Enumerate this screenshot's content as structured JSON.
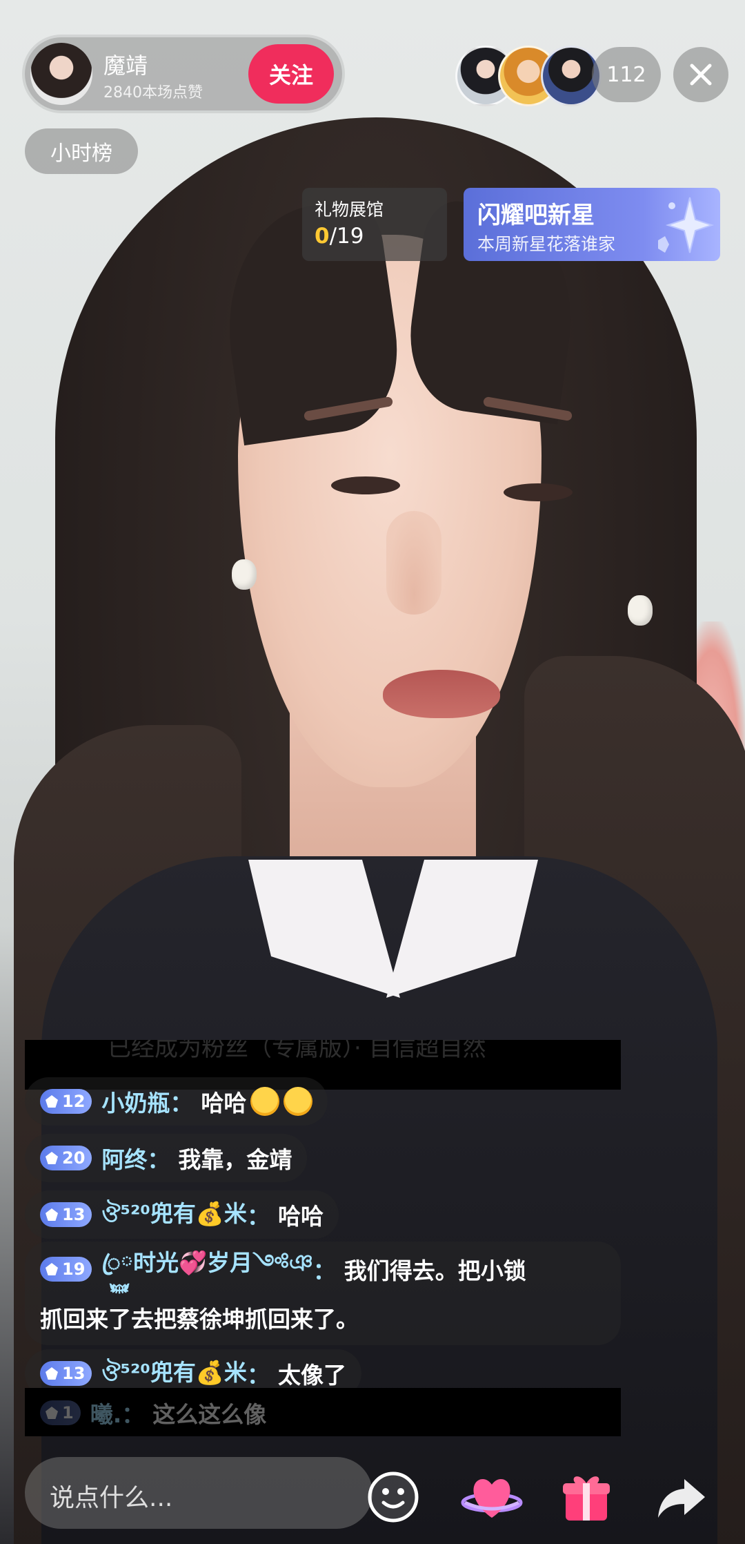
{
  "host": {
    "name": "魔靖",
    "likes": "2840本场点赞",
    "follow_label": "关注"
  },
  "viewers": {
    "count": "112"
  },
  "hour_rank_label": "小时榜",
  "gift_hall": {
    "title": "礼物展馆",
    "progress_current": "0",
    "progress_total": "/19"
  },
  "star_banner": {
    "title": "闪耀吧新星",
    "subtitle": "本周新星花落谁家"
  },
  "chat": {
    "cut_top": "已经成为粉丝（专属版）· 自信超自然",
    "messages": [
      {
        "level": "12",
        "user": "小奶瓶",
        "text": "哈哈"
      },
      {
        "level": "20",
        "user": "阿终",
        "text": "我靠，金靖"
      },
      {
        "level": "13",
        "user": "ঔ⁵²⁰兜有💰米",
        "text": "哈哈"
      },
      {
        "level": "19",
        "user": "ꦿ࿆时光💞岁月༺ঞ",
        "text": "我们得去。把小锁",
        "text2": "抓回来了去把蔡徐坤抓回来了。"
      },
      {
        "level": "13",
        "user": "ঔ⁵²⁰兜有💰米",
        "text": "太像了"
      }
    ],
    "cut_bottom": {
      "level": "1",
      "user": "曦.",
      "text": "这么这么像"
    }
  },
  "input": {
    "placeholder": "说点什么..."
  },
  "colors": {
    "follow_red": "#f02d5c",
    "username_blue": "#a6e3ff",
    "badge_blue": "#6f8df3",
    "progress_yellow": "#ffc933",
    "banner_purple": "#6b7de6"
  },
  "icons": [
    "close-icon",
    "emoji-icon",
    "heart-planet-icon",
    "gift-icon",
    "share-icon"
  ]
}
